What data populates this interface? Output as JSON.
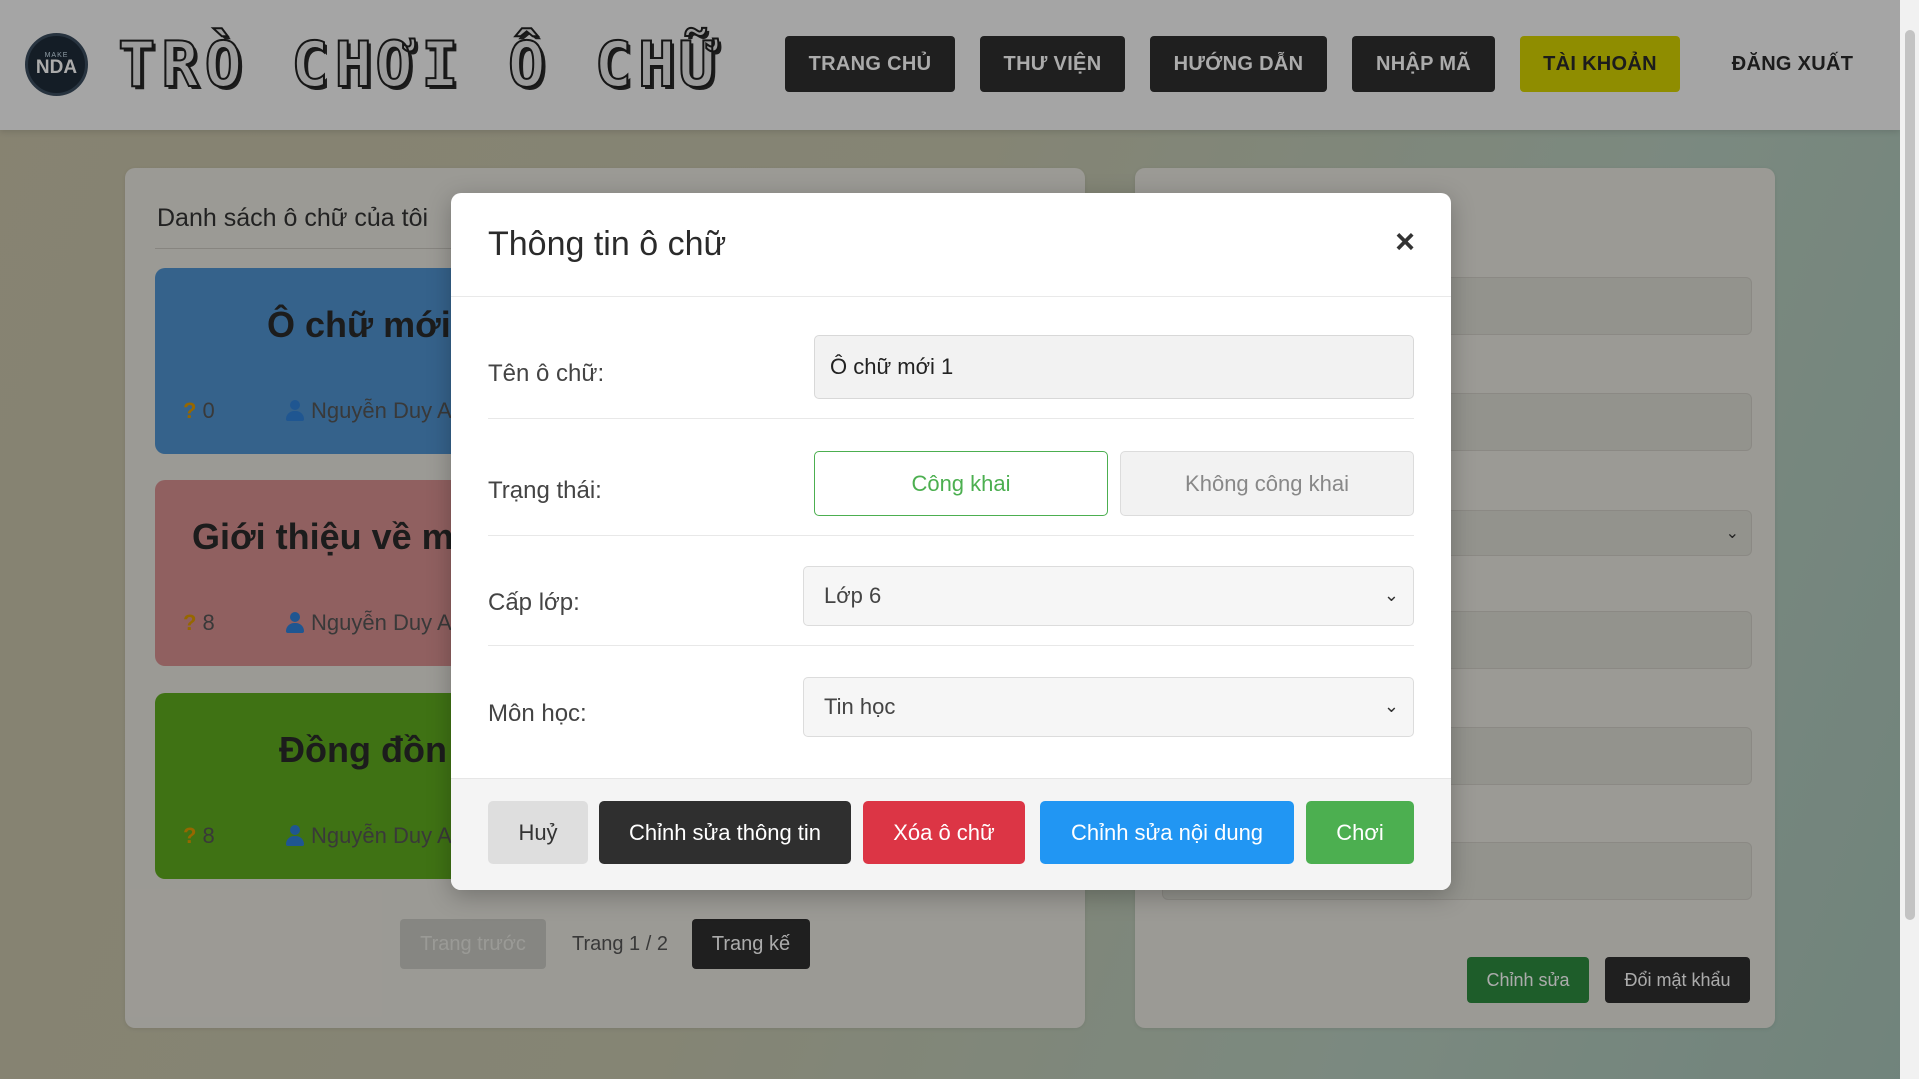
{
  "header": {
    "logo_small": "MAKE",
    "logo_text": "NDA",
    "site_title": "TRÒ CHƠI Ô CHỮ",
    "nav": [
      "TRANG CHỦ",
      "THƯ VIỆN",
      "HƯỚNG DẪN",
      "NHẬP MÃ",
      "TÀI KHOẢN",
      "ĐĂNG XUẤT"
    ]
  },
  "list_panel": {
    "title": "Danh sách ô chữ của tôi",
    "cards": [
      {
        "title": "Ô chữ mới",
        "questions": "0",
        "author": "Nguyễn Duy A",
        "color": "#4f92cf"
      },
      {
        "title": "Giới thiệu về m",
        "questions": "8",
        "author": "Nguyễn Duy A",
        "color": "#d78f90"
      },
      {
        "title": "Đồng đồn",
        "questions": "8",
        "author": "Nguyễn Duy A",
        "color": "#5faa1e"
      }
    ],
    "pager": {
      "prev": "Trang trước",
      "info": "Trang 1 / 2",
      "next": "Trang kế"
    }
  },
  "account_panel": {
    "edit_button": "Chỉnh sửa",
    "change_password_button": "Đổi mật khẩu"
  },
  "modal": {
    "title": "Thông tin ô chữ",
    "close": "×",
    "name_label": "Tên ô chữ:",
    "name_value": "Ô chữ mới 1",
    "status_label": "Trạng thái:",
    "status_public": "Công khai",
    "status_private": "Không công khai",
    "grade_label": "Cấp lớp:",
    "grade_value": "Lớp 6",
    "subject_label": "Môn học:",
    "subject_value": "Tin học",
    "buttons": {
      "cancel": "Huỷ",
      "edit_info": "Chỉnh sửa thông tin",
      "delete": "Xóa ô chữ",
      "edit_content": "Chỉnh sửa nội dung",
      "play": "Chơi"
    },
    "colors": {
      "delete": "#dc3545",
      "edit_content": "#2196f3",
      "play": "#4caf50",
      "dark": "#2f2f2f"
    }
  }
}
